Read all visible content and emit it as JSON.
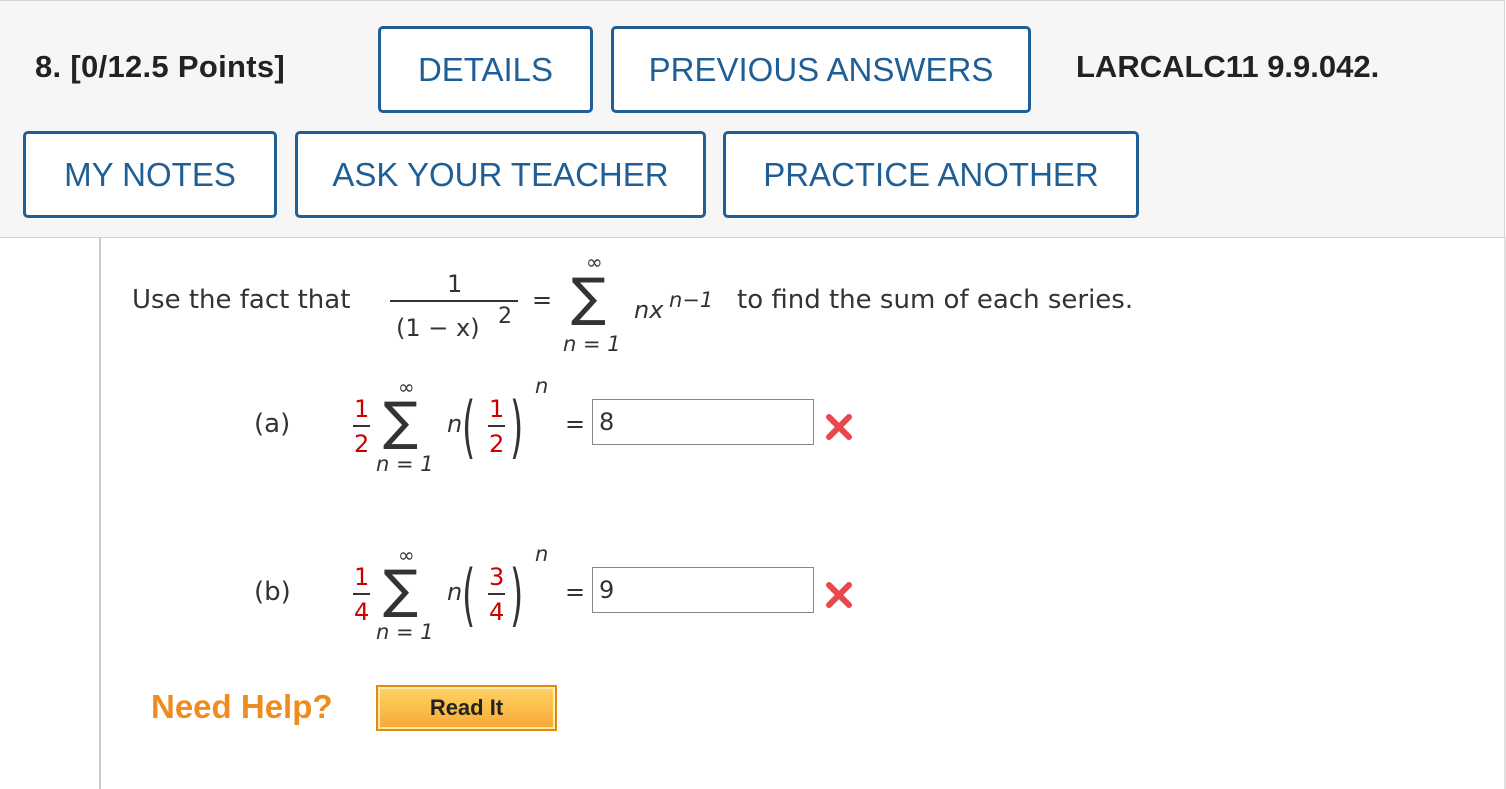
{
  "question": {
    "number_points": "8.  [0/12.5 Points]",
    "code": "LARCALC11 9.9.042."
  },
  "buttons": {
    "details": "DETAILS",
    "previous_answers": "PREVIOUS ANSWERS",
    "my_notes": "MY NOTES",
    "ask_teacher": "ASK YOUR TEACHER",
    "practice_another": "PRACTICE ANOTHER"
  },
  "prompt": {
    "lead": "Use the fact that",
    "numerator": "1",
    "denominator": "(1 − x)",
    "denominator_exp": "2",
    "equals": "=",
    "sum_upper": "∞",
    "sum_lower": "n = 1",
    "term": "nx",
    "term_exp": "n−1",
    "tail": "to find the sum of each series."
  },
  "parts": [
    {
      "label": "(a)",
      "coef_num": "1",
      "coef_den": "2",
      "sum_upper": "∞",
      "sum_lower": "n = 1",
      "n_symbol": "n",
      "inner_num": "1",
      "inner_den": "2",
      "exponent": "n",
      "equals": "=",
      "answer": "8",
      "status": "incorrect"
    },
    {
      "label": "(b)",
      "coef_num": "1",
      "coef_den": "4",
      "sum_upper": "∞",
      "sum_lower": "n = 1",
      "n_symbol": "n",
      "inner_num": "3",
      "inner_den": "4",
      "exponent": "n",
      "equals": "=",
      "answer": "9",
      "status": "incorrect"
    }
  ],
  "help": {
    "label": "Need Help?",
    "read_it": "Read It"
  },
  "colors": {
    "button_blue": "#1f5f96",
    "help_orange": "#ef8c1f",
    "error_red": "#e8474c",
    "math_red": "#cc0000"
  },
  "icons": {
    "incorrect": "x-mark-icon"
  }
}
